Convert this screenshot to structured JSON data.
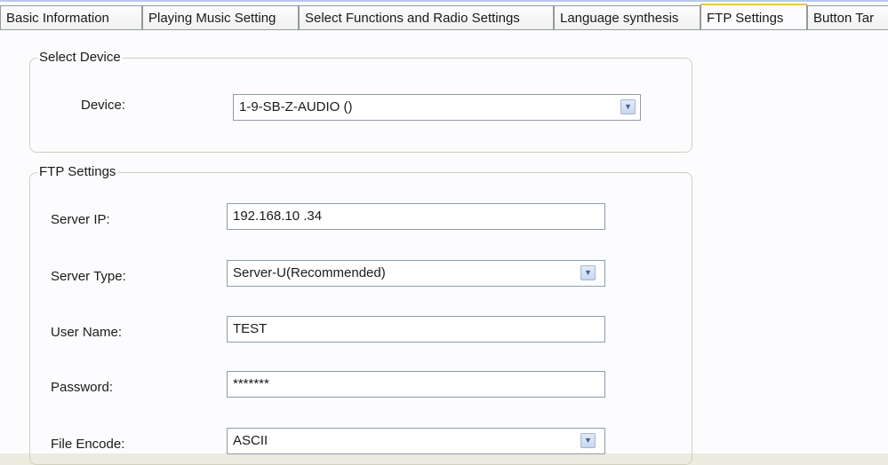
{
  "tabs": [
    {
      "label": "Basic Information"
    },
    {
      "label": "Playing Music Setting"
    },
    {
      "label": "Select Functions and Radio Settings"
    },
    {
      "label": "Language synthesis"
    },
    {
      "label": "FTP Settings"
    },
    {
      "label": "Button Tar"
    }
  ],
  "select_device": {
    "title": "Select Device",
    "device_label": "Device:",
    "device_value": "1-9-SB-Z-AUDIO ()"
  },
  "ftp": {
    "title": "FTP Settings",
    "server_ip_label": "Server IP:",
    "server_ip_value": "192.168.10 .34",
    "server_type_label": "Server Type:",
    "server_type_value": "Server-U(Recommended)",
    "user_name_label": "User Name:",
    "user_name_value": "TEST",
    "password_label": "Password:",
    "password_value": "*******",
    "file_encode_label": "File Encode:",
    "file_encode_value": "ASCII"
  },
  "icons": {
    "dropdown": "chevron-down-icon"
  },
  "colors": {
    "tab_active_accent": "#f0c44a",
    "panel_background": "#fcfcfe",
    "window_background": "#ecebdf"
  }
}
